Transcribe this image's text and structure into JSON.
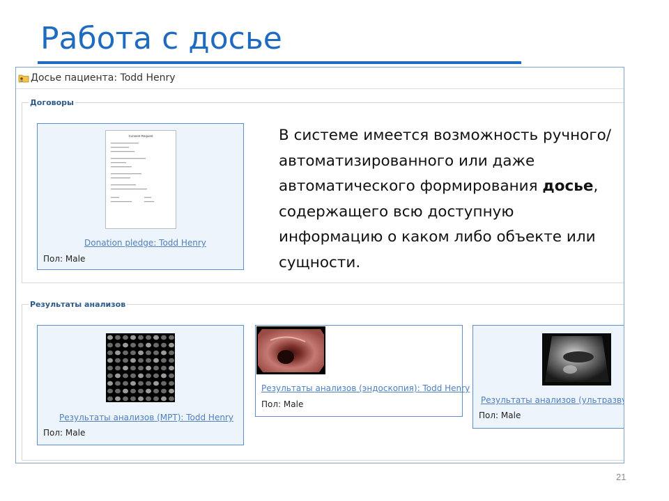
{
  "slide": {
    "title": "Работа с досье",
    "page_number": "21",
    "accent_color": "#1f6bbf"
  },
  "window": {
    "icon": "folder-user-icon",
    "title": "Досье пациента: Todd Henry"
  },
  "contracts": {
    "legend": "Договоры",
    "card": {
      "link": "Donation pledge: Todd Henry",
      "gender_label": "Пол:",
      "gender_value": "Male",
      "thumbnail": "document-thumbnail",
      "doc_heading": "Consent Request"
    }
  },
  "description": {
    "part1": "В системе имеется возможность ручного/автоматизированного или даже автоматического формирования ",
    "bold": "досье",
    "part2": ", содержащего всю доступную информацию о каком либо объекте или сущности."
  },
  "results": {
    "legend": "Результаты анализов",
    "cards": [
      {
        "link": "Результаты анализов (МРТ): Todd Henry",
        "gender_label": "Пол:",
        "gender_value": "Male",
        "thumbnail": "mri-grid-thumbnail"
      },
      {
        "link": "Результаты анализов (эндоскопия): Todd Henry",
        "gender_label": "Пол:",
        "gender_value": "Male",
        "thumbnail": "endoscopy-thumbnail"
      },
      {
        "link": "Результаты анализов (ультразвук)",
        "gender_label": "Пол:",
        "gender_value": "Male",
        "thumbnail": "ultrasound-thumbnail"
      }
    ]
  }
}
